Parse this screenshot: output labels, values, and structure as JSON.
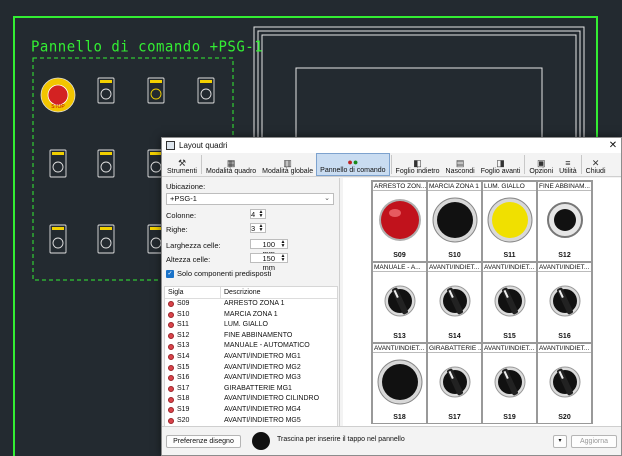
{
  "cad": {
    "panel_title": "Pannello di comando +PSG-1",
    "emergency_text": "STOP"
  },
  "dialog": {
    "title": "Layout quadri",
    "ribbon": [
      {
        "label": "Strumenti",
        "icon": "tools-icon"
      },
      {
        "label": "Modalità quadro",
        "icon": "panel-mode-icon"
      },
      {
        "label": "Modalità globale",
        "icon": "global-mode-icon"
      },
      {
        "label": "Pannello di comando",
        "icon": "control-panel-icon",
        "active": true
      },
      {
        "label": "Foglio indietro",
        "icon": "sheet-back-icon"
      },
      {
        "label": "Nascondi",
        "icon": "hide-icon"
      },
      {
        "label": "Foglio avanti",
        "icon": "sheet-forward-icon"
      },
      {
        "label": "Opzioni",
        "icon": "options-icon"
      },
      {
        "label": "Utilità",
        "icon": "utility-icon"
      },
      {
        "label": "Chiudi",
        "icon": "close-icon"
      }
    ],
    "form": {
      "ubicazione_label": "Ubicazione:",
      "ubicazione_value": "+PSG-1",
      "colonne_label": "Colonne:",
      "colonne_value": "4",
      "righe_label": "Righe:",
      "righe_value": "3",
      "larghezza_label": "Larghezza celle:",
      "larghezza_value": "100 mm",
      "altezza_label": "Altezza celle:",
      "altezza_value": "150 mm",
      "solo_label": "Solo componenti predisposti"
    },
    "table": {
      "headers": [
        "Sigla",
        "Descrizione"
      ],
      "rows": [
        [
          "S09",
          "ARRESTO ZONA 1"
        ],
        [
          "S10",
          "MARCIA ZONA 1"
        ],
        [
          "S11",
          "LUM. GIALLO"
        ],
        [
          "S12",
          "FINE ABBINAMENTO"
        ],
        [
          "S13",
          "MANUALE - AUTOMATICO"
        ],
        [
          "S14",
          "AVANTI/INDIETRO MG1"
        ],
        [
          "S15",
          "AVANTI/INDIETRO MG2"
        ],
        [
          "S16",
          "AVANTI/INDIETRO MG3"
        ],
        [
          "S17",
          "GIRABATTERIE MG1"
        ],
        [
          "S18",
          "AVANTI/INDIETRO CILINDRO"
        ],
        [
          "S19",
          "AVANTI/INDIETRO MG4"
        ],
        [
          "S20",
          "AVANTI/INDIETRO MG5"
        ]
      ]
    },
    "grid": [
      {
        "header": "ARRESTO ZON...",
        "code": "S09",
        "kind": "red"
      },
      {
        "header": "MARCIA ZONA 1",
        "code": "S10",
        "kind": "black"
      },
      {
        "header": "LUM. GIALLO",
        "code": "S11",
        "kind": "yellow"
      },
      {
        "header": "FINE ABBINAM...",
        "code": "S12",
        "kind": "small-black"
      },
      {
        "header": "MANUALE - A...",
        "code": "S13",
        "kind": "selector"
      },
      {
        "header": "AVANTI/INDIET...",
        "code": "S14",
        "kind": "selector"
      },
      {
        "header": "AVANTI/INDIET...",
        "code": "S15",
        "kind": "selector"
      },
      {
        "header": "AVANTI/INDIET...",
        "code": "S16",
        "kind": "selector"
      },
      {
        "header": "AVANTI/INDIET...",
        "code": "S18",
        "kind": "black"
      },
      {
        "header": "GIRABATTERIE ...",
        "code": "S17",
        "kind": "selector"
      },
      {
        "header": "AVANTI/INDIET...",
        "code": "S19",
        "kind": "selector"
      },
      {
        "header": "AVANTI/INDIET...",
        "code": "S20",
        "kind": "selector"
      }
    ],
    "footer": {
      "pref_button": "Preferenze disegno",
      "hint": "Trascina per inserire il tappo nel pannello",
      "add_button": "Aggiorna"
    }
  }
}
